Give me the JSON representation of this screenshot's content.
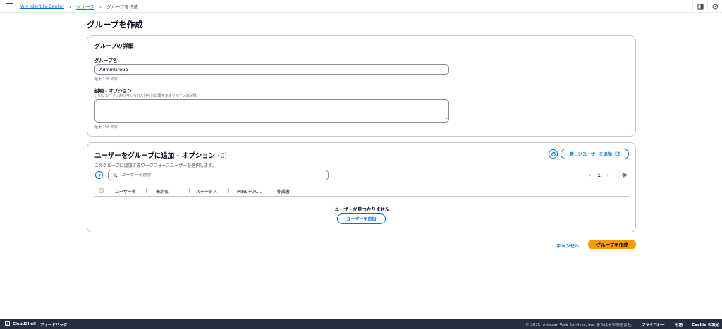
{
  "breadcrumb": {
    "items": [
      "IAM Identity Center",
      "グループ"
    ],
    "current": "グループを作成"
  },
  "page": {
    "title": "グループを作成"
  },
  "details": {
    "title": "グループの詳細",
    "name_label": "グループ名",
    "name_value": "AdminGroup",
    "name_hint": "最大 128 文字",
    "desc_label": "説明 - オプション",
    "desc_help": "このグループに割り当てられた許可の詳細を示すグループの説明。",
    "desc_value": "-",
    "desc_hint": "最大 256 文字"
  },
  "users": {
    "title": "ユーザーをグループに追加 - オプション",
    "count": "(0)",
    "description": "このグループに追加するワークフォースユーザーを選択します。",
    "new_user_button": "新しいユーザーを追加",
    "search_placeholder": "ユーザーを検索",
    "page_number": "1",
    "columns": [
      "ユーザー名",
      "表示名",
      "ステータス",
      "MFA デバ...",
      "作成者"
    ],
    "empty_message": "ユーザーが見つかりません",
    "add_user_button": "ユーザーを追加"
  },
  "actions": {
    "cancel": "キャンセル",
    "create": "グループを作成"
  },
  "footer": {
    "cloudshell": "CloudShell",
    "feedback": "フィードバック",
    "copyright": "© 2025, Amazon Web Services, Inc. またはその関連会社。",
    "privacy": "プライバシー",
    "terms": "用語",
    "cookie": "Cookie の設定"
  },
  "colors": {
    "link": "#0972d3",
    "primary_button": "#ff9900",
    "footer_bg": "#232f3e"
  }
}
